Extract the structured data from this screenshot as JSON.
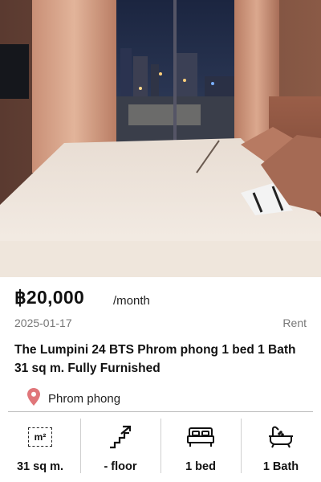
{
  "listing": {
    "price": "฿20,000",
    "period": "/month",
    "date": "2025-01-17",
    "type": "Rent",
    "title": "The Lumpini 24 BTS Phrom phong 1 bed 1 Bath  31 sq m. Fully Furnished",
    "location": "Phrom phong"
  },
  "features": {
    "area_icon_text": "m²",
    "area": "31 sq m.",
    "floor": "- floor",
    "beds": "1 bed",
    "baths": "1 Bath"
  },
  "colors": {
    "location_pin": "#e0767a",
    "text": "#111111",
    "muted": "#777777"
  },
  "icons": [
    "map-pin-icon",
    "area-icon",
    "stairs-icon",
    "bed-icon",
    "bathtub-icon"
  ]
}
